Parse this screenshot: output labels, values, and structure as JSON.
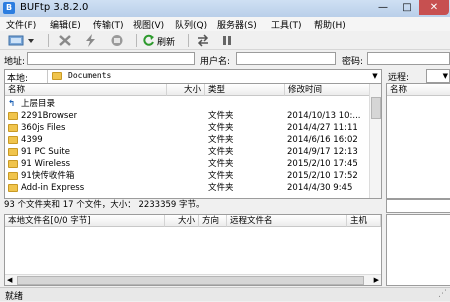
{
  "window": {
    "title": "BUFtp 3.8.2.0",
    "min_glyph": "—",
    "max_glyph": "□",
    "close_glyph": "✕"
  },
  "menu": [
    "文件(F)",
    "编辑(E)",
    "传输(T)",
    "视图(V)",
    "队列(Q)",
    "服务器(S)",
    "工具(T)",
    "帮助(H)"
  ],
  "toolbar": {
    "refresh_label": "刷新"
  },
  "connect": {
    "address_label": "地址:",
    "username_label": "用户名:",
    "password_label": "密码:",
    "address_value": "",
    "username_value": "",
    "password_value": ""
  },
  "local": {
    "label": "本地:",
    "path": "Documents",
    "columns": {
      "name": "名称",
      "size": "大小",
      "type": "类型",
      "modified": "修改时间"
    },
    "up_dir": "上层目录",
    "rows": [
      {
        "name": "2291Browser",
        "type": "文件夹",
        "modified": "2014/10/13 10:..."
      },
      {
        "name": "360js Files",
        "type": "文件夹",
        "modified": "2014/4/27 11:11"
      },
      {
        "name": "4399",
        "type": "文件夹",
        "modified": "2014/6/16 16:02"
      },
      {
        "name": "91 PC Suite",
        "type": "文件夹",
        "modified": "2014/9/17 12:13"
      },
      {
        "name": "91 Wireless",
        "type": "文件夹",
        "modified": "2015/2/10 17:45"
      },
      {
        "name": "91快传收件箱",
        "type": "文件夹",
        "modified": "2015/2/10 17:52"
      },
      {
        "name": "Add-in Express",
        "type": "文件夹",
        "modified": "2014/4/30 9:45"
      }
    ],
    "status": "93 个文件夹和 17 个文件，大小： 2233359 字节。"
  },
  "remote": {
    "label": "远程:",
    "column_name": "名称"
  },
  "queue": {
    "columns": {
      "local": "本地文件名[0/0 字节]",
      "size": "大小",
      "direction": "方向",
      "remote": "远程文件名",
      "host": "主机"
    }
  },
  "status_bar": {
    "text": "就绪"
  }
}
